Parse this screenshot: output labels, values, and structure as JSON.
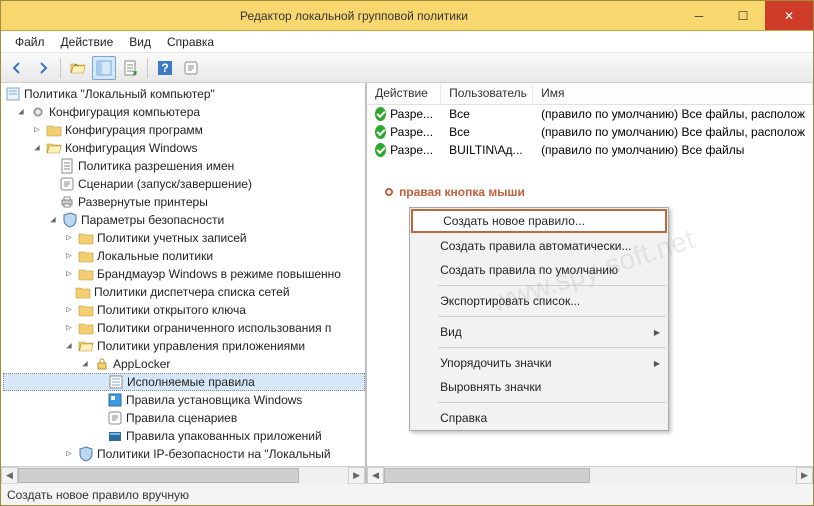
{
  "window": {
    "title": "Редактор локальной групповой политики"
  },
  "menubar": [
    "Файл",
    "Действие",
    "Вид",
    "Справка"
  ],
  "tree": {
    "root": "Политика \"Локальный компьютер\"",
    "n1": "Конфигурация компьютера",
    "n2": "Конфигурация программ",
    "n3": "Конфигурация Windows",
    "n4": "Политика разрешения имен",
    "n5": "Сценарии (запуск/завершение)",
    "n6": "Развернутые принтеры",
    "n7": "Параметры безопасности",
    "n8": "Политики учетных записей",
    "n9": "Локальные политики",
    "n10": "Брандмауэр Windows в режиме повышенно",
    "n11": "Политики диспетчера списка сетей",
    "n12": "Политики открытого ключа",
    "n13": "Политики ограниченного использования п",
    "n14": "Политики управления приложениями",
    "n15": "AppLocker",
    "n16": "Исполняемые правила",
    "n17": "Правила установщика Windows",
    "n18": "Правила сценариев",
    "n19": "Правила упакованных приложений",
    "n20": "Политики IP-безопасности на \"Локальный "
  },
  "list": {
    "cols": {
      "c1": "Действие",
      "c2": "Пользователь",
      "c3": "Имя"
    },
    "rows": [
      {
        "action": "Разре...",
        "user": "Все",
        "name": "(правило по умолчанию) Все файлы, располож"
      },
      {
        "action": "Разре...",
        "user": "Все",
        "name": "(правило по умолчанию) Все файлы, располож"
      },
      {
        "action": "Разре...",
        "user": "BUILTIN\\Ад...",
        "name": "(правило по умолчанию) Все файлы"
      }
    ]
  },
  "annot": "правая кнопка мыши",
  "ctx": {
    "i1": "Создать новое правило...",
    "i2": "Создать правила автоматически...",
    "i3": "Создать правила по умолчанию",
    "i4": "Экспортировать список...",
    "i5": "Вид",
    "i6": "Упорядочить значки",
    "i7": "Выровнять значки",
    "i8": "Справка"
  },
  "status": "Создать новое правило вручную",
  "watermark": "www.spy-soft.net"
}
